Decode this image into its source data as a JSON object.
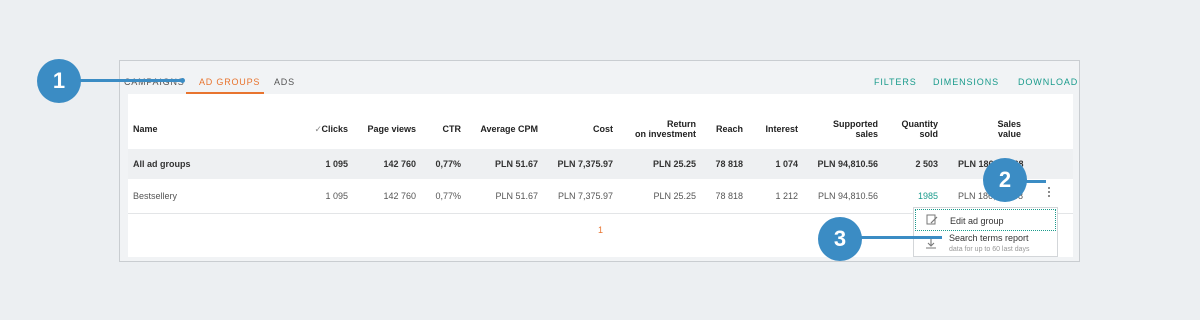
{
  "tabs": [
    {
      "label": "CAMPAIGNS"
    },
    {
      "label": "AD GROUPS"
    },
    {
      "label": "ADS"
    }
  ],
  "actions": [
    {
      "label": "FILTERS"
    },
    {
      "label": "DIMENSIONS"
    },
    {
      "label": "DOWNLOAD"
    }
  ],
  "table": {
    "sort_indicator": "✓",
    "headers": [
      "Name",
      "Clicks",
      "Page views",
      "CTR",
      "Average CPM",
      "Cost",
      "Return",
      "on investment",
      "Reach",
      "Interest",
      "Supported",
      "sales",
      "Quantity",
      "sold",
      "Sales",
      "value"
    ],
    "total_row": [
      "All ad groups",
      "1 095",
      "142 760",
      "0,77%",
      "PLN 51.67",
      "PLN 7,375.97",
      "PLN 25.25",
      "78 818",
      "1 074",
      "PLN 94,810.56",
      "2 503",
      "PLN 186,333.68"
    ],
    "data_row": [
      "Bestsellery",
      "1 095",
      "142 760",
      "0,77%",
      "PLN 51.67",
      "PLN 7,375.97",
      "PLN 25.25",
      "78 818",
      "1 212",
      "PLN 94,810.56",
      "1985",
      "PLN 186,333.68"
    ]
  },
  "pagination": {
    "current": "1"
  },
  "row_menu": {
    "edit_label": "Edit ad group",
    "report_label": "Search terms report",
    "report_sub": "data for up to 60 last days"
  },
  "callouts": [
    "1",
    "2",
    "3"
  ],
  "colors": {
    "accent_orange": "#e8742f",
    "accent_teal": "#1a9b8c",
    "callout_blue": "#3b8cc4"
  }
}
